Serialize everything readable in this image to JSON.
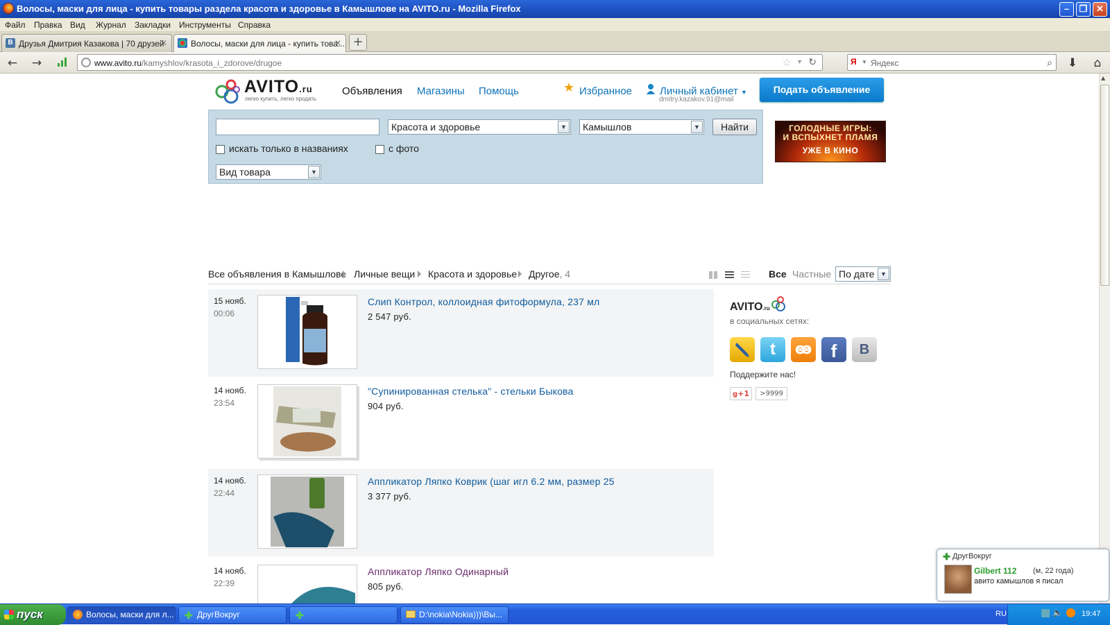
{
  "window": {
    "title": "Волосы, маски для лица - купить товары раздела красота и здоровье в Камышлове на AVITO.ru - Mozilla Firefox"
  },
  "menu": [
    "Файл",
    "Правка",
    "Вид",
    "Журнал",
    "Закладки",
    "Инструменты",
    "Справка"
  ],
  "tabs": [
    {
      "label": "Друзья Дмитрия Казакова | 70 друзей",
      "active": false
    },
    {
      "label": "Волосы, маски для лица - купить това...",
      "active": true
    }
  ],
  "nav": {
    "url_domain": "www.avito.ru",
    "url_path": "/kamyshlov/krasota_i_zdorove/drugoe",
    "search_engine": "Яндекс"
  },
  "site": {
    "logo_text": "AVITO",
    "logo_tld": ".ru",
    "logo_tagline": "легко купить, легко продать",
    "nav": [
      "Объявления",
      "Магазины",
      "Помощь"
    ],
    "favorites": "Избранное",
    "account": "Личный кабинет",
    "account_email": "dmitry.kazakov.91@mail",
    "post_button": "Подать объявление"
  },
  "search": {
    "query": "",
    "category": "Красота и здоровье",
    "location": "Камышлов",
    "find_button": "Найти",
    "only_titles": "искать только в названиях",
    "with_photo": "с фото",
    "product_type": "Вид товара"
  },
  "banner": {
    "line1": "ГОЛОДНЫЕ ИГРЫ:",
    "line2": "И ВСПЫХНЕТ ПЛАМЯ",
    "line3": "УЖЕ В КИНО"
  },
  "breadcrumbs": [
    "Все объявления в Камышлове",
    "Личные вещи",
    "Красота и здоровье",
    "Другое"
  ],
  "breadcrumb_count": ", 4",
  "filters": {
    "all": "Все",
    "private": "Частные",
    "sort": "По дате"
  },
  "listings": [
    {
      "date": "15 нояб.",
      "time": "00:06",
      "title": "Слип Контрол, коллоидная фитоформула, 237 мл",
      "price": "2 547 руб."
    },
    {
      "date": "14 нояб.",
      "time": "23:54",
      "title": "\"Супинированная стелька\" - стельки Быкова",
      "price": "904 руб."
    },
    {
      "date": "14 нояб.",
      "time": "22:44",
      "title": "Аппликатор Ляпко Коврик (шаг игл 6.2 мм, размер 25",
      "price": "3 377 руб."
    },
    {
      "date": "14 нояб.",
      "time": "22:39",
      "title": "Аппликатор Ляпко Одинарный",
      "price": "805 руб."
    }
  ],
  "sidebar": {
    "logo": "AVITO",
    "logo_tld": ".ru",
    "social_label": "в социальных сетях:",
    "support": "Поддержите нас!",
    "gplus": "+1",
    "gplus_count": ">9999"
  },
  "notification": {
    "app": "ДругВокруг",
    "user": "Gilbert 112",
    "user_meta": "(м, 22 года)",
    "message": "авито камышлов я писал"
  },
  "taskbar": {
    "start": "пуск",
    "buttons": [
      "Волосы, маски для л...",
      "ДругВокруг",
      "",
      "D:\\nokia\\Nokia)))\\Вы..."
    ],
    "lang": "RU",
    "clock": "19:47"
  },
  "colors": {
    "link": "#0e73b8",
    "accent": "#0a79c9",
    "panel": "#c6dae6"
  }
}
